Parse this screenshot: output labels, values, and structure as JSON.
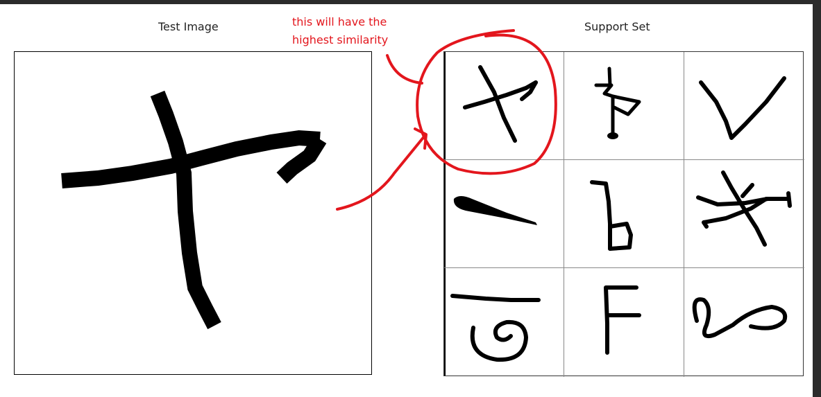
{
  "test_panel": {
    "title": "Test Image"
  },
  "support_panel": {
    "title": "Support Set",
    "cells": [
      "character-ya-icon",
      "character-flag-icon",
      "character-v-icon",
      "character-dash-icon",
      "character-b-icon",
      "character-asterisk-icon",
      "character-swirl-icon",
      "character-f-icon",
      "character-loop-icon"
    ]
  },
  "annotation": {
    "line1": "this will have the",
    "line2": "highest similarity",
    "color": "#e3161d"
  }
}
